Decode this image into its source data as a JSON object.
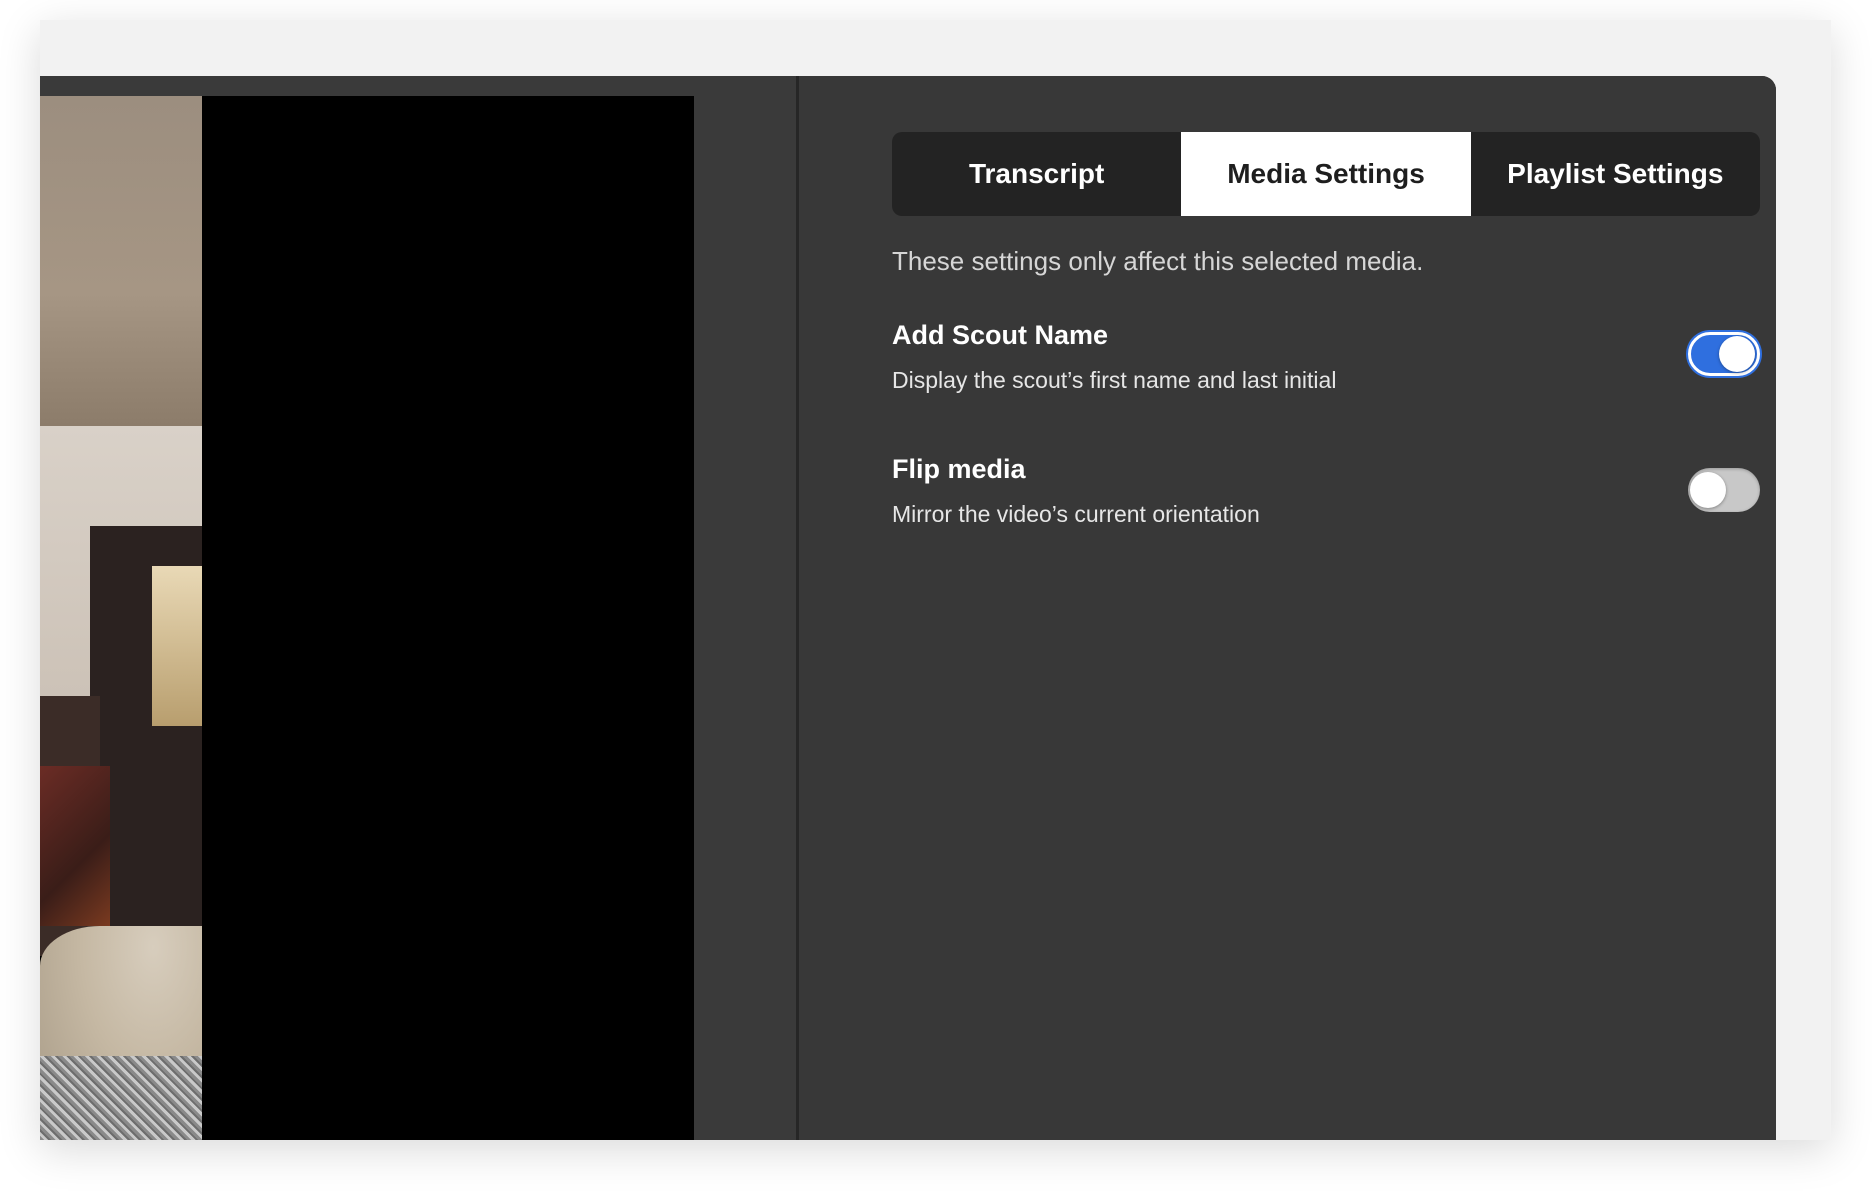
{
  "tabs": [
    {
      "label": "Transcript",
      "active": false
    },
    {
      "label": "Media Settings",
      "active": true
    },
    {
      "label": "Playlist Settings",
      "active": false
    }
  ],
  "description": "These settings only affect this selected media.",
  "settings": [
    {
      "title": "Add Scout Name",
      "subtitle": "Display the scout’s first name and last initial",
      "enabled": true
    },
    {
      "title": "Flip media",
      "subtitle": "Mirror the video’s current orientation",
      "enabled": false
    }
  ],
  "colors": {
    "toggle_on": "#2f6fdf",
    "toggle_off": "#c8c8c8",
    "panel_bg": "#383838",
    "tab_bar_bg": "#232323"
  }
}
